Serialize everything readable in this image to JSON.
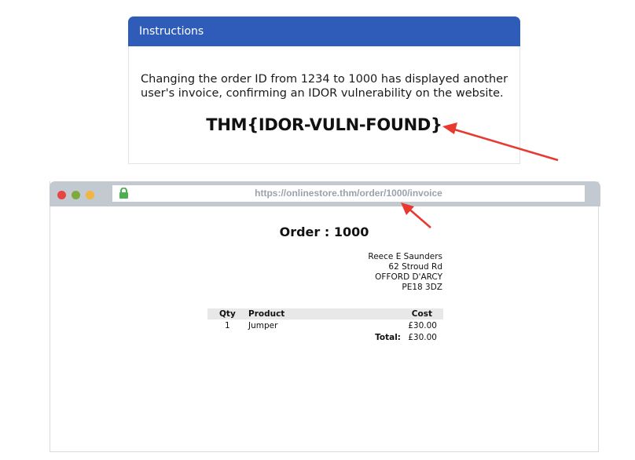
{
  "instructions": {
    "title": "Instructions",
    "text": "Changing the order ID from 1234 to 1000 has displayed another user's invoice, confirming an IDOR vulnerability on the website.",
    "flag": "THM{IDOR-VULN-FOUND}"
  },
  "browser": {
    "url": "https://onlinestore.thm/order/1000/invoice",
    "icons": [
      "close-dot",
      "minimize-dot",
      "maximize-dot",
      "lock-icon"
    ]
  },
  "order": {
    "title": "Order : 1000",
    "address": [
      "Reece E Saunders",
      "62 Stroud Rd",
      "OFFORD D'ARCY",
      "PE18 3DZ"
    ],
    "table": {
      "headers": {
        "qty": "Qty",
        "product": "Product",
        "cost": "Cost"
      },
      "rows": [
        {
          "qty": "1",
          "product": "Jumper",
          "cost": "£30.00"
        }
      ],
      "total_label": "Total:",
      "total_value": "£30.00"
    }
  },
  "colors": {
    "header_blue": "#2e5cb8",
    "annotation_red": "#e8382f",
    "browser_bar": "#c2c9d0"
  }
}
